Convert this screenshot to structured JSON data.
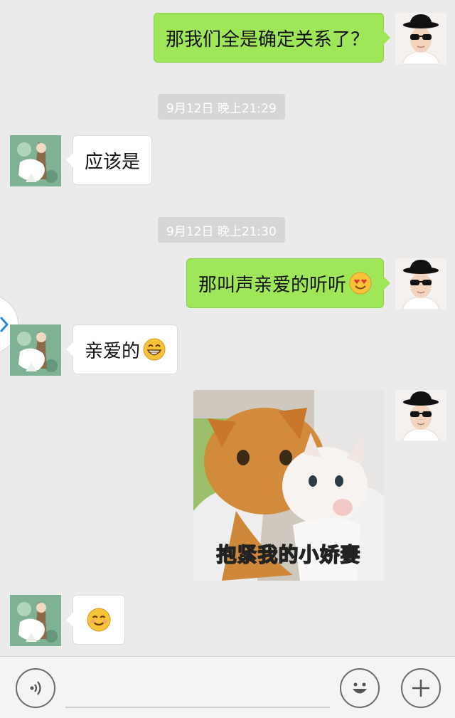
{
  "messages": [
    {
      "side": "right",
      "text": "那我们全是确定关系了？"
    },
    {
      "side": "left",
      "text": "应该是"
    },
    {
      "side": "right",
      "text": "那叫声亲爱的听听",
      "emoji": "heart-eyes-emoji"
    },
    {
      "side": "left",
      "text": "亲爱的",
      "emoji": "grinning-emoji"
    },
    {
      "side": "right",
      "type": "sticker",
      "caption": "抱紧我的小娇妻"
    },
    {
      "side": "left",
      "emoji": "smiling-emoji"
    }
  ],
  "timestamps": [
    "9月12日 晚上21:29",
    "9月12日 晚上21:30"
  ],
  "colors": {
    "sent_bubble": "#9fe658",
    "received_bubble": "#ffffff",
    "background": "#ebebeb",
    "emoji_yellow": "#f7c338"
  },
  "input_bar": {
    "voice_icon": "voice-icon",
    "emoji_icon": "smiley-face-icon",
    "plus_icon": "plus-icon"
  }
}
